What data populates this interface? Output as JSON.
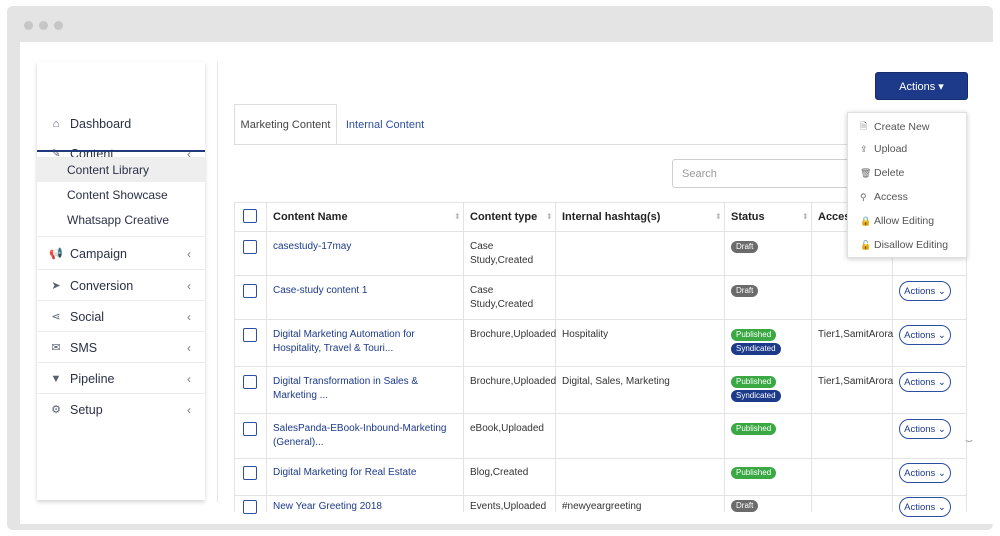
{
  "sidebar": {
    "items": [
      {
        "label": "Dashboard",
        "icon": "home-icon",
        "glyph": "⌂"
      },
      {
        "label": "Content",
        "icon": "edit-icon",
        "glyph": "✎",
        "chevron": "‹"
      },
      {
        "label": "Campaign",
        "icon": "megaphone-icon",
        "glyph": "📢",
        "chevron": "‹"
      },
      {
        "label": "Conversion",
        "icon": "cursor-icon",
        "glyph": "➤",
        "chevron": "‹"
      },
      {
        "label": "Social",
        "icon": "share-icon",
        "glyph": "⋖",
        "chevron": "‹"
      },
      {
        "label": "SMS",
        "icon": "envelope-icon",
        "glyph": "✉",
        "chevron": "‹"
      },
      {
        "label": "Pipeline",
        "icon": "filter-icon",
        "glyph": "▼",
        "chevron": "‹"
      },
      {
        "label": "Setup",
        "icon": "gear-icon",
        "glyph": "⚙",
        "chevron": "‹"
      }
    ],
    "submenu": [
      "Content Library",
      "Content Showcase",
      "Whatsapp Creative"
    ]
  },
  "tabs": [
    "Marketing Content",
    "Internal Content"
  ],
  "search": {
    "placeholder": "Search"
  },
  "actions_button": "Actions ▾",
  "dropdown": [
    {
      "label": "Create New",
      "glyph": "🗎",
      "icon": "document-icon"
    },
    {
      "label": "Upload",
      "glyph": "⇪",
      "icon": "upload-icon"
    },
    {
      "label": "Delete",
      "glyph": "🗑",
      "icon": "trash-icon"
    },
    {
      "label": "Access",
      "glyph": "⚲",
      "icon": "key-icon"
    },
    {
      "label": "Allow Editing",
      "glyph": "🔒",
      "icon": "lock-icon"
    },
    {
      "label": "Disallow Editing",
      "glyph": "🔓",
      "icon": "unlock-icon"
    }
  ],
  "table": {
    "headers": [
      "Content Name",
      "Content type",
      "Internal hashtag(s)",
      "Status",
      "Access"
    ],
    "row_action": "Actions ⌄",
    "rows": [
      {
        "name": "casestudy-17may",
        "type": "Case Study,Created",
        "hashtags": "",
        "status": [
          "Draft"
        ],
        "access": ""
      },
      {
        "name": "Case-study content 1",
        "type": "Case Study,Created",
        "hashtags": "",
        "status": [
          "Draft"
        ],
        "access": ""
      },
      {
        "name": "Digital Marketing Automation for Hospitality, Travel & Touri...",
        "type": "Brochure,Uploaded",
        "hashtags": "Hospitality",
        "status": [
          "Published",
          "Syndicated"
        ],
        "access": "Tier1,SamitArora"
      },
      {
        "name": "Digital Transformation in Sales & Marketing ...",
        "type": "Brochure,Uploaded",
        "hashtags": "Digital, Sales, Marketing",
        "status": [
          "Published",
          "Syndicated"
        ],
        "access": "Tier1,SamitArora"
      },
      {
        "name": "SalesPanda-EBook-Inbound-Marketing (General)...",
        "type": "eBook,Uploaded",
        "hashtags": "",
        "status": [
          "Published"
        ],
        "access": ""
      },
      {
        "name": "Digital Marketing for Real Estate",
        "type": "Blog,Created",
        "hashtags": "",
        "status": [
          "Published"
        ],
        "access": ""
      },
      {
        "name": "New Year Greeting 2018",
        "type": "Events,Uploaded",
        "hashtags": "#newyeargreeting",
        "status": [
          "Draft"
        ],
        "access": ""
      }
    ]
  },
  "colors": {
    "primary": "#1d3a8a",
    "draft": "#6b6b6b",
    "published": "#3aa843",
    "syndicated": "#1d3a8a"
  }
}
